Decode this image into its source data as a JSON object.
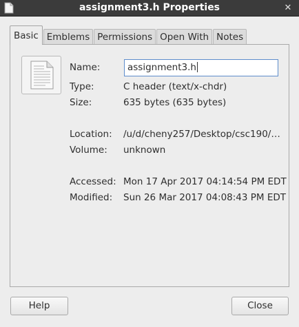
{
  "window": {
    "title": "assignment3.h Properties",
    "close_glyph": "✕"
  },
  "tabs": [
    {
      "label": "Basic",
      "active": true
    },
    {
      "label": "Emblems",
      "active": false
    },
    {
      "label": "Permissions",
      "active": false
    },
    {
      "label": "Open With",
      "active": false
    },
    {
      "label": "Notes",
      "active": false
    }
  ],
  "basic": {
    "icon": "text-file-icon",
    "name_label": "Name:",
    "name_value": "assignment3.h",
    "type_label": "Type:",
    "type_value": "C header (text/x-chdr)",
    "size_label": "Size:",
    "size_value": "635 bytes (635 bytes)",
    "location_label": "Location:",
    "location_value": "/u/d/cheny257/Desktop/csc190/…",
    "volume_label": "Volume:",
    "volume_value": "unknown",
    "accessed_label": "Accessed:",
    "accessed_value": "Mon 17 Apr 2017 04:14:54 PM EDT",
    "modified_label": "Modified:",
    "modified_value": "Sun 26 Mar 2017 04:08:43 PM EDT"
  },
  "buttons": {
    "help": "Help",
    "close": "Close"
  },
  "colors": {
    "titlebar": "#3b3b3b",
    "input_border": "#5d8ccb",
    "background": "#ededed"
  }
}
